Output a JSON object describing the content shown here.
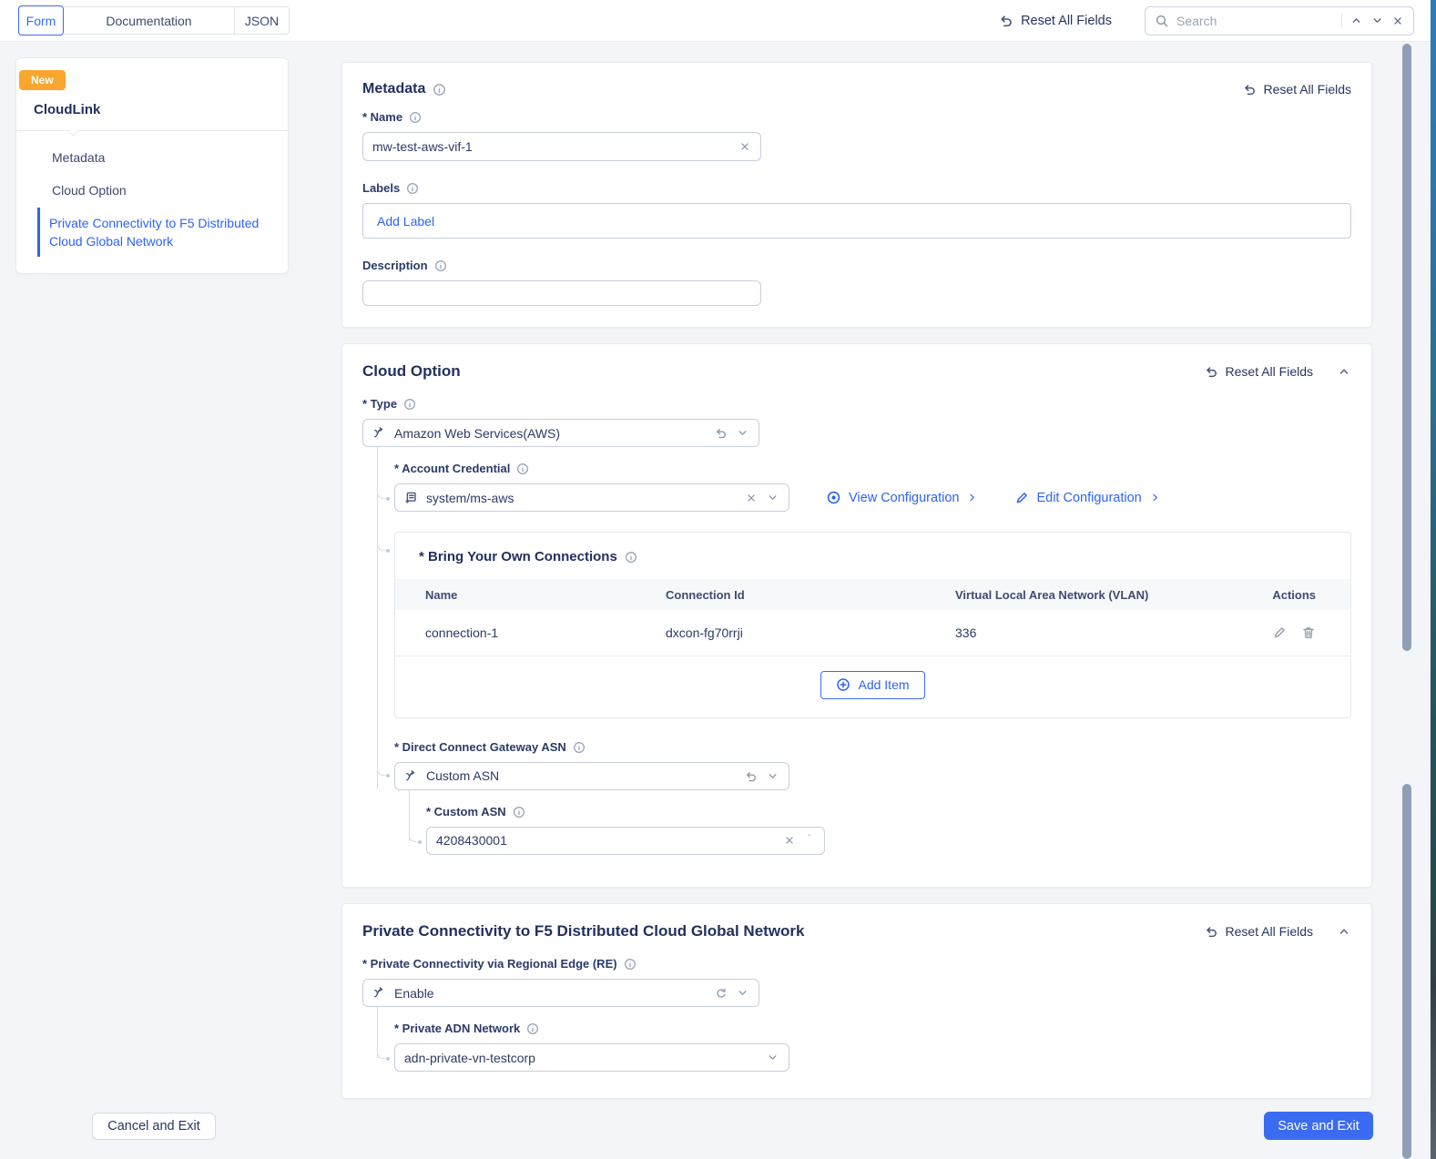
{
  "topbar": {
    "tabs": [
      {
        "label": "Form"
      },
      {
        "label": "Documentation"
      },
      {
        "label": "JSON"
      }
    ],
    "reset_all_label": "Reset All Fields",
    "search": {
      "placeholder": "Search"
    }
  },
  "sidebar": {
    "badge": "New",
    "title": "CloudLink",
    "items": [
      {
        "label": "Metadata",
        "active": false
      },
      {
        "label": "Cloud Option",
        "active": false
      },
      {
        "label": "Private Connectivity to F5 Distributed Cloud Global Network",
        "active": true
      }
    ]
  },
  "metadata": {
    "title": "Metadata",
    "reset_label": "Reset All Fields",
    "name_label": "* Name",
    "name_value": "mw-test-aws-vif-1",
    "labels_label": "Labels",
    "add_label_placeholder": "Add Label",
    "description_label": "Description",
    "description_value": ""
  },
  "cloud_option": {
    "title": "Cloud Option",
    "reset_label": "Reset All Fields",
    "type_label": "* Type",
    "type_value": "Amazon Web Services(AWS)",
    "account_credential_label": "* Account Credential",
    "account_credential_value": "system/ms-aws",
    "view_configuration_label": "View Configuration",
    "edit_configuration_label": "Edit Configuration",
    "byoc": {
      "title": "* Bring Your Own Connections",
      "columns": [
        "Name",
        "Connection Id",
        "Virtual Local Area Network (VLAN)",
        "Actions"
      ],
      "rows": [
        {
          "name": "connection-1",
          "connection_id": "dxcon-fg70rrji",
          "vlan": "336"
        }
      ],
      "add_item_label": "Add Item"
    },
    "dcg_asn_label": "* Direct Connect Gateway ASN",
    "dcg_asn_value": "Custom ASN",
    "custom_asn_label": "* Custom ASN",
    "custom_asn_value": "4208430001"
  },
  "private_connectivity": {
    "title": "Private Connectivity to F5 Distributed Cloud Global Network",
    "reset_label": "Reset All Fields",
    "re_label": "* Private Connectivity via Regional Edge (RE)",
    "re_value": "Enable",
    "adn_label": "* Private ADN Network",
    "adn_value": "adn-private-vn-testcorp"
  },
  "footer": {
    "cancel_label": "Cancel and Exit",
    "save_label": "Save and Exit"
  },
  "colors": {
    "accent": "#3b6bf2",
    "navy": "#22305e",
    "orange": "#f9a62e"
  }
}
